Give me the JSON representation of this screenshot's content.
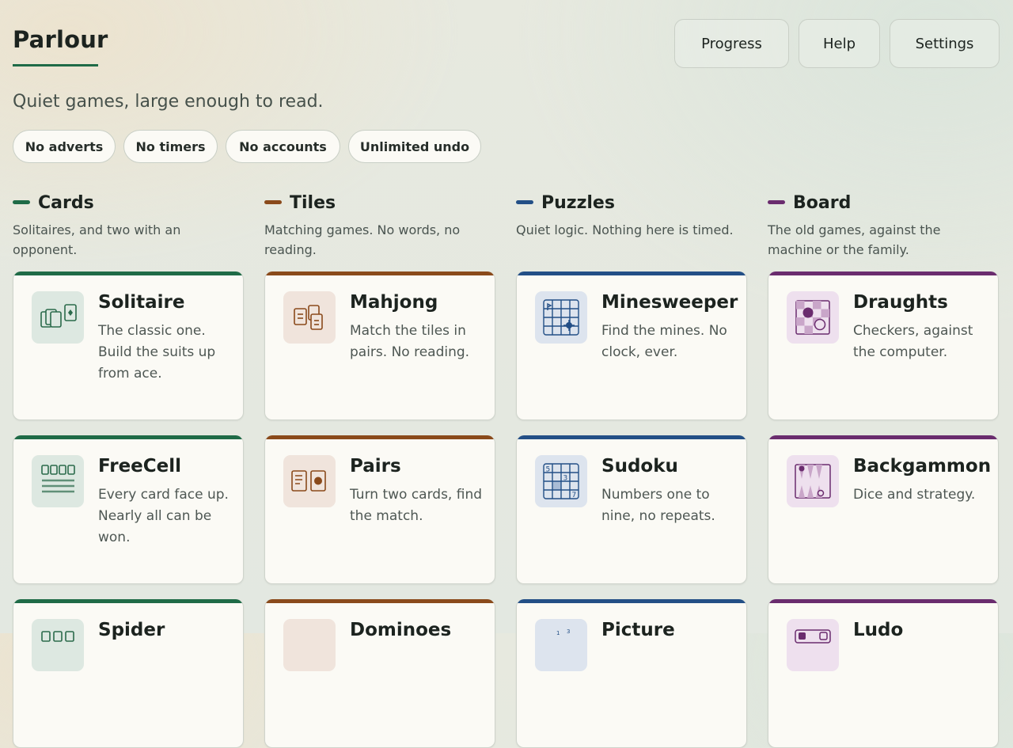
{
  "header": {
    "brand": "Parlour",
    "nav": [
      "Progress",
      "Help",
      "Settings"
    ],
    "tagline": "Quiet games, large enough to read."
  },
  "chips": [
    "No adverts",
    "No timers",
    "No accounts",
    "Unlimited undo"
  ],
  "colors": {
    "cards": "#1f6b47",
    "tiles": "#8a4a1b",
    "puzzles": "#234f86",
    "board": "#6a2c6e"
  },
  "categories": [
    {
      "label": "Cards",
      "desc": "Solitaires, and two with an opponent.",
      "games": [
        {
          "title": "Solitaire",
          "desc": "The classic one. Build the suits up from ace.",
          "icon": "playing-cards-icon"
        },
        {
          "title": "FreeCell",
          "desc": "Every card face up. Nearly all can be won.",
          "icon": "freecell-icon"
        },
        {
          "title": "Spider",
          "desc": "",
          "icon": "spider-icon"
        }
      ]
    },
    {
      "label": "Tiles",
      "desc": "Matching games. No words, no reading.",
      "games": [
        {
          "title": "Mahjong",
          "desc": "Match the tiles in pairs. No reading.",
          "icon": "mahjong-tiles-icon"
        },
        {
          "title": "Pairs",
          "desc": "Turn two cards, find the match.",
          "icon": "pairs-icon"
        },
        {
          "title": "Dominoes",
          "desc": "",
          "icon": "dominoes-icon"
        }
      ]
    },
    {
      "label": "Puzzles",
      "desc": "Quiet logic. Nothing here is timed.",
      "games": [
        {
          "title": "Minesweeper",
          "desc": "Find the mines. No clock, ever.",
          "icon": "minesweeper-icon"
        },
        {
          "title": "Sudoku",
          "desc": "Numbers one to nine, no repeats.",
          "icon": "sudoku-grid-icon"
        },
        {
          "title": "Picture",
          "desc": "",
          "icon": "picture-puzzle-icon"
        }
      ]
    },
    {
      "label": "Board",
      "desc": "The old games, against the machine or the family.",
      "games": [
        {
          "title": "Draughts",
          "desc": "Checkers, against the computer.",
          "icon": "draughts-icon"
        },
        {
          "title": "Backgammon",
          "desc": "Dice and strategy.",
          "icon": "backgammon-icon"
        },
        {
          "title": "Ludo",
          "desc": "",
          "icon": "ludo-icon"
        }
      ]
    }
  ]
}
